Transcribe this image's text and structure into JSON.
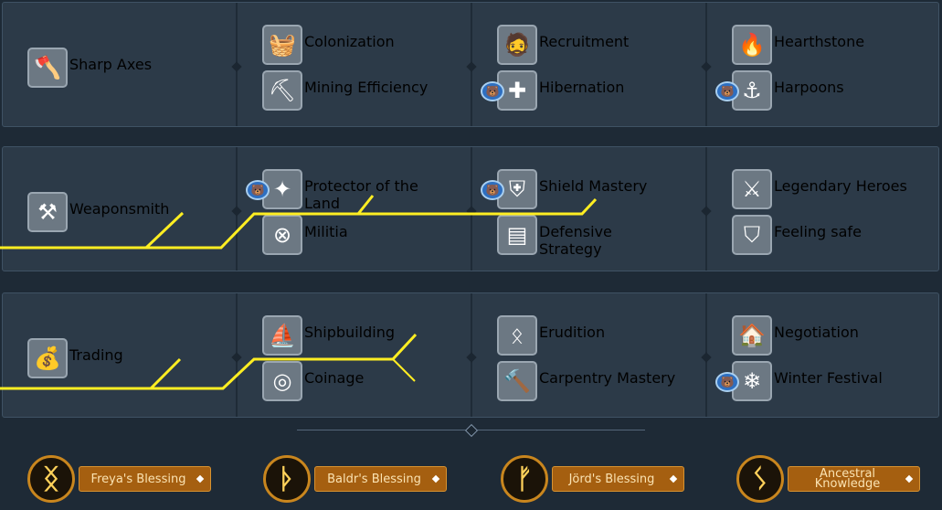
{
  "rows": [
    {
      "root": {
        "label": "Sharp Axes",
        "icon": "axe-icon",
        "glyph": "🪓"
      },
      "cols": [
        [
          {
            "label": "Colonization",
            "icon": "basket-icon",
            "glyph": "🧺"
          },
          {
            "label": "Mining Efficiency",
            "icon": "pickaxe-icon",
            "glyph": "⛏"
          }
        ],
        [
          {
            "label": "Recruitment",
            "icon": "warrior-icon",
            "glyph": "🧔"
          },
          {
            "label": "Hibernation",
            "icon": "plus-icon",
            "glyph": "✚",
            "badge": true
          }
        ],
        [
          {
            "label": "Hearthstone",
            "icon": "fire-icon",
            "glyph": "🔥"
          },
          {
            "label": "Harpoons",
            "icon": "harpoon-icon",
            "glyph": "⚓",
            "badge": true
          }
        ]
      ]
    },
    {
      "root": {
        "label": "Weaponsmith",
        "icon": "anvil-icon",
        "glyph": "⚒"
      },
      "cols": [
        [
          {
            "label": "Protector of the Land",
            "icon": "shield-icon",
            "glyph": "✦",
            "badge": true
          },
          {
            "label": "Militia",
            "icon": "round-shield-icon",
            "glyph": "⊗"
          }
        ],
        [
          {
            "label": "Shield Mastery",
            "icon": "shield-icon",
            "glyph": "⛨",
            "badge": true
          },
          {
            "label": "Defensive Strategy",
            "icon": "tower-icon",
            "glyph": "▤"
          }
        ],
        [
          {
            "label": "Legendary Heroes",
            "icon": "axes-icon",
            "glyph": "⚔"
          },
          {
            "label": "Feeling safe",
            "icon": "crest-icon",
            "glyph": "⛉"
          }
        ]
      ]
    },
    {
      "root": {
        "label": "Trading",
        "icon": "coins-icon",
        "glyph": "💰"
      },
      "cols": [
        [
          {
            "label": "Shipbuilding",
            "icon": "ship-icon",
            "glyph": "⛵"
          },
          {
            "label": "Coinage",
            "icon": "coin-icon",
            "glyph": "◎"
          }
        ],
        [
          {
            "label": "Erudition",
            "icon": "rune-stone-icon",
            "glyph": "ᛟ"
          },
          {
            "label": "Carpentry Mastery",
            "icon": "hammer-icon",
            "glyph": "🔨"
          }
        ],
        [
          {
            "label": "Negotiation",
            "icon": "market-icon",
            "glyph": "🏠"
          },
          {
            "label": "Winter Festival",
            "icon": "snowflake-icon",
            "glyph": "❄",
            "badge": true
          }
        ]
      ]
    }
  ],
  "blessings": [
    {
      "label": "Freya's Blessing",
      "rune": "ᛝ",
      "icon": "freya-rune-icon"
    },
    {
      "label": "Baldr's Blessing",
      "rune": "ᚦ",
      "icon": "baldr-rune-icon"
    },
    {
      "label": "Jörd's Blessing",
      "rune": "ᚠ",
      "icon": "jord-rune-icon"
    },
    {
      "label": "Ancestral Knowledge",
      "rune": "ᛊ",
      "icon": "ancestral-rune-icon"
    }
  ],
  "badge_glyph": "🐻",
  "colors": {
    "path": "#ffee22",
    "node_bg": "#1f5e80",
    "gold_bg": "#a55f10"
  }
}
